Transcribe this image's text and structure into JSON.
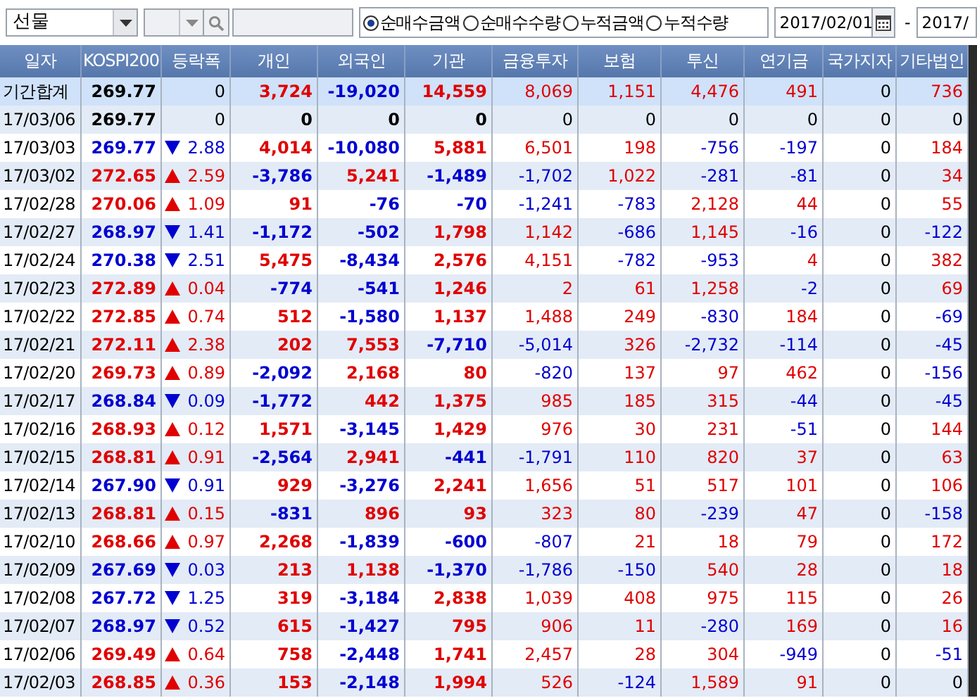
{
  "toolbar": {
    "market": "선물",
    "modes": [
      {
        "label": "순매수금액",
        "selected": true
      },
      {
        "label": "순매수수량",
        "selected": false
      },
      {
        "label": "누적금액",
        "selected": false
      },
      {
        "label": "누적수량",
        "selected": false
      }
    ],
    "date_from": "2017/02/01",
    "separator": "-",
    "date_to": "2017/"
  },
  "table": {
    "columns": [
      "일자",
      "KOSPI200",
      "등락폭",
      "개인",
      "외국인",
      "기관",
      "금융투자",
      "보험",
      "투신",
      "연기금",
      "국가지자",
      "기타법인"
    ],
    "rows": [
      {
        "kind": "total",
        "date": "기간합계",
        "kospi": "269.77",
        "up": false,
        "down": false,
        "change": "0",
        "values": [
          "3,724",
          "-19,020",
          "14,559",
          "8,069",
          "1,151",
          "4,476",
          "491",
          "0",
          "736"
        ]
      },
      {
        "kind": "day",
        "date": "17/03/06",
        "kospi": "269.77",
        "up": false,
        "down": false,
        "change": "0",
        "values": [
          "0",
          "0",
          "0",
          "0",
          "0",
          "0",
          "0",
          "0",
          "0"
        ]
      },
      {
        "kind": "day",
        "date": "17/03/03",
        "kospi": "269.77",
        "up": false,
        "down": true,
        "change": "2.88",
        "values": [
          "4,014",
          "-10,080",
          "5,881",
          "6,501",
          "198",
          "-756",
          "-197",
          "0",
          "184"
        ]
      },
      {
        "kind": "day",
        "date": "17/03/02",
        "kospi": "272.65",
        "up": true,
        "down": false,
        "change": "2.59",
        "values": [
          "-3,786",
          "5,241",
          "-1,489",
          "-1,702",
          "1,022",
          "-281",
          "-81",
          "0",
          "34"
        ]
      },
      {
        "kind": "day",
        "date": "17/02/28",
        "kospi": "270.06",
        "up": true,
        "down": false,
        "change": "1.09",
        "values": [
          "91",
          "-76",
          "-70",
          "-1,241",
          "-783",
          "2,128",
          "44",
          "0",
          "55"
        ]
      },
      {
        "kind": "day",
        "date": "17/02/27",
        "kospi": "268.97",
        "up": false,
        "down": true,
        "change": "1.41",
        "values": [
          "-1,172",
          "-502",
          "1,798",
          "1,142",
          "-686",
          "1,145",
          "-16",
          "0",
          "-122"
        ]
      },
      {
        "kind": "day",
        "date": "17/02/24",
        "kospi": "270.38",
        "up": false,
        "down": true,
        "change": "2.51",
        "values": [
          "5,475",
          "-8,434",
          "2,576",
          "4,151",
          "-782",
          "-953",
          "4",
          "0",
          "382"
        ]
      },
      {
        "kind": "day",
        "date": "17/02/23",
        "kospi": "272.89",
        "up": true,
        "down": false,
        "change": "0.04",
        "values": [
          "-774",
          "-541",
          "1,246",
          "2",
          "61",
          "1,258",
          "-2",
          "0",
          "69"
        ]
      },
      {
        "kind": "day",
        "date": "17/02/22",
        "kospi": "272.85",
        "up": true,
        "down": false,
        "change": "0.74",
        "values": [
          "512",
          "-1,580",
          "1,137",
          "1,488",
          "249",
          "-830",
          "184",
          "0",
          "-69"
        ]
      },
      {
        "kind": "day",
        "date": "17/02/21",
        "kospi": "272.11",
        "up": true,
        "down": false,
        "change": "2.38",
        "values": [
          "202",
          "7,553",
          "-7,710",
          "-5,014",
          "326",
          "-2,732",
          "-114",
          "0",
          "-45"
        ]
      },
      {
        "kind": "day",
        "date": "17/02/20",
        "kospi": "269.73",
        "up": true,
        "down": false,
        "change": "0.89",
        "values": [
          "-2,092",
          "2,168",
          "80",
          "-820",
          "137",
          "97",
          "462",
          "0",
          "-156"
        ]
      },
      {
        "kind": "day",
        "date": "17/02/17",
        "kospi": "268.84",
        "up": false,
        "down": true,
        "change": "0.09",
        "values": [
          "-1,772",
          "442",
          "1,375",
          "985",
          "185",
          "315",
          "-44",
          "0",
          "-45"
        ]
      },
      {
        "kind": "day",
        "date": "17/02/16",
        "kospi": "268.93",
        "up": true,
        "down": false,
        "change": "0.12",
        "values": [
          "1,571",
          "-3,145",
          "1,429",
          "976",
          "30",
          "231",
          "-51",
          "0",
          "144"
        ]
      },
      {
        "kind": "day",
        "date": "17/02/15",
        "kospi": "268.81",
        "up": true,
        "down": false,
        "change": "0.91",
        "values": [
          "-2,564",
          "2,941",
          "-441",
          "-1,791",
          "110",
          "820",
          "37",
          "0",
          "63"
        ]
      },
      {
        "kind": "day",
        "date": "17/02/14",
        "kospi": "267.90",
        "up": false,
        "down": true,
        "change": "0.91",
        "values": [
          "929",
          "-3,276",
          "2,241",
          "1,656",
          "51",
          "517",
          "101",
          "0",
          "106"
        ]
      },
      {
        "kind": "day",
        "date": "17/02/13",
        "kospi": "268.81",
        "up": true,
        "down": false,
        "change": "0.15",
        "values": [
          "-831",
          "896",
          "93",
          "323",
          "80",
          "-239",
          "47",
          "0",
          "-158"
        ]
      },
      {
        "kind": "day",
        "date": "17/02/10",
        "kospi": "268.66",
        "up": true,
        "down": false,
        "change": "0.97",
        "values": [
          "2,268",
          "-1,839",
          "-600",
          "-807",
          "21",
          "18",
          "79",
          "0",
          "172"
        ]
      },
      {
        "kind": "day",
        "date": "17/02/09",
        "kospi": "267.69",
        "up": false,
        "down": true,
        "change": "0.03",
        "values": [
          "213",
          "1,138",
          "-1,370",
          "-1,786",
          "-150",
          "540",
          "28",
          "0",
          "18"
        ]
      },
      {
        "kind": "day",
        "date": "17/02/08",
        "kospi": "267.72",
        "up": false,
        "down": true,
        "change": "1.25",
        "values": [
          "319",
          "-3,184",
          "2,838",
          "1,039",
          "408",
          "975",
          "115",
          "0",
          "26"
        ]
      },
      {
        "kind": "day",
        "date": "17/02/07",
        "kospi": "268.97",
        "up": false,
        "down": true,
        "change": "0.52",
        "values": [
          "615",
          "-1,427",
          "795",
          "906",
          "11",
          "-280",
          "169",
          "0",
          "16"
        ]
      },
      {
        "kind": "day",
        "date": "17/02/06",
        "kospi": "269.49",
        "up": true,
        "down": false,
        "change": "0.64",
        "values": [
          "758",
          "-2,448",
          "1,741",
          "2,457",
          "28",
          "304",
          "-949",
          "0",
          "-51"
        ]
      },
      {
        "kind": "day",
        "date": "17/02/03",
        "kospi": "268.85",
        "up": true,
        "down": false,
        "change": "0.36",
        "values": [
          "153",
          "-2,148",
          "1,994",
          "526",
          "-124",
          "1,589",
          "91",
          "0",
          "0"
        ]
      }
    ]
  }
}
